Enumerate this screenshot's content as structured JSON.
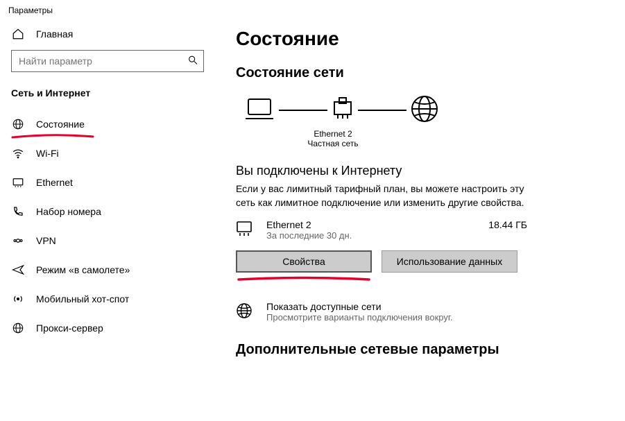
{
  "window": {
    "title": "Параметры"
  },
  "sidebar": {
    "home": "Главная",
    "searchPlaceholder": "Найти параметр",
    "section": "Сеть и Интернет",
    "items": [
      {
        "label": "Состояние"
      },
      {
        "label": "Wi-Fi"
      },
      {
        "label": "Ethernet"
      },
      {
        "label": "Набор номера"
      },
      {
        "label": "VPN"
      },
      {
        "label": "Режим «в самолете»"
      },
      {
        "label": "Мобильный хот-спот"
      },
      {
        "label": "Прокси-сервер"
      }
    ]
  },
  "main": {
    "title": "Состояние",
    "netStatus": "Состояние сети",
    "diagram": {
      "name": "Ethernet 2",
      "type": "Частная сеть"
    },
    "connectedHeading": "Вы подключены к Интернету",
    "connectedBody": "Если у вас лимитный тарифный план, вы можете настроить эту сеть как лимитное подключение или изменить другие свойства.",
    "connection": {
      "name": "Ethernet 2",
      "period": "За последние 30 дн.",
      "usage": "18.44 ГБ"
    },
    "buttons": {
      "properties": "Свойства",
      "dataUsage": "Использование данных"
    },
    "available": {
      "title": "Показать доступные сети",
      "sub": "Просмотрите варианты подключения вокруг."
    },
    "advanced": "Дополнительные сетевые параметры"
  }
}
